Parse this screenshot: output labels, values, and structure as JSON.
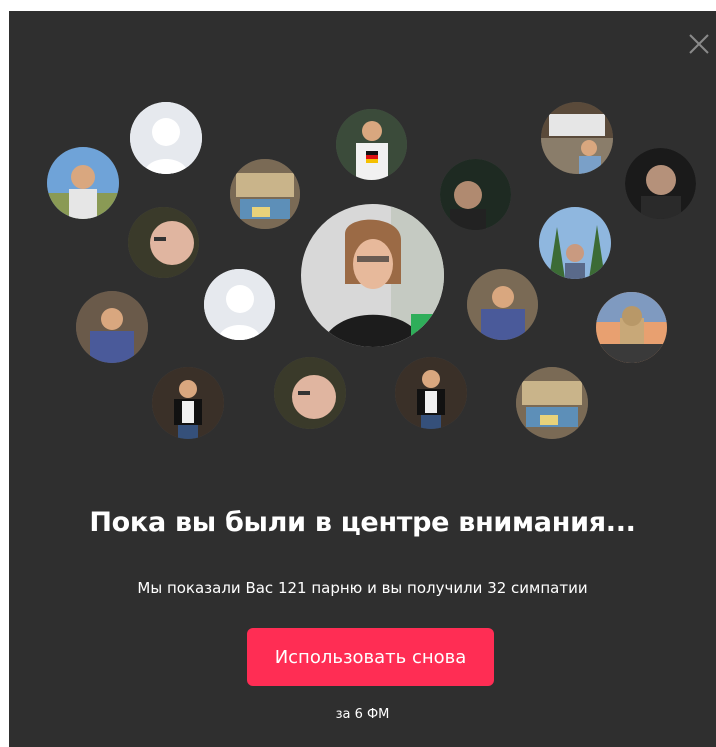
{
  "modal": {
    "title": "Пока вы были в центре внимания...",
    "subtitle": "Мы показали Вас 121 парню и вы получили 32 симпатии",
    "cta_label": "Использовать снова",
    "price_label": "за 6 ФМ",
    "close_icon": "close-icon"
  },
  "colors": {
    "background": "#2f2f2f",
    "accent": "#ff2d54",
    "text": "#ffffff"
  }
}
